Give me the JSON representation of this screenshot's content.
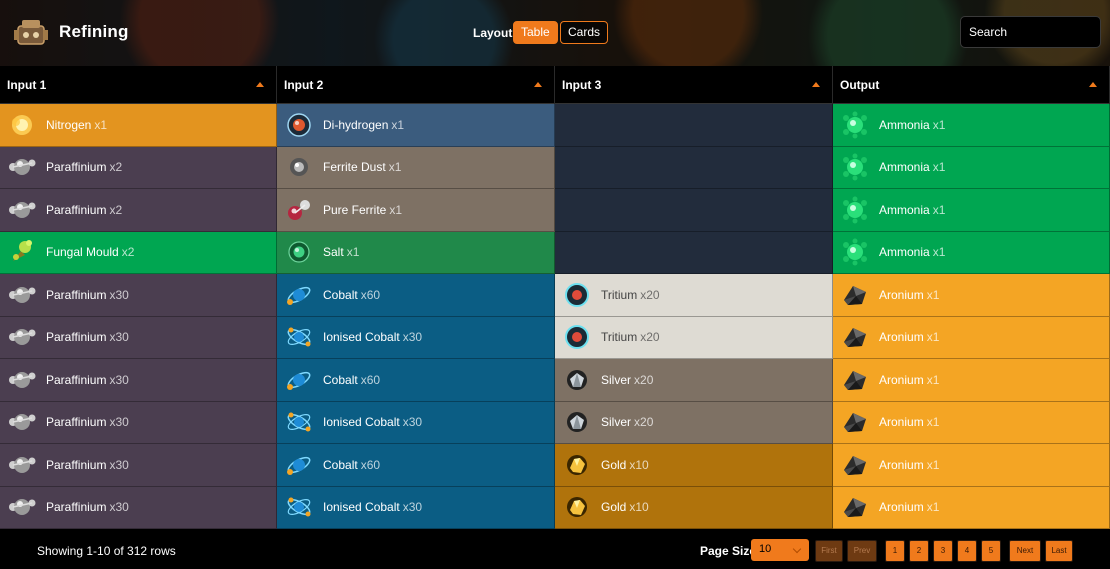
{
  "header": {
    "title": "Refining",
    "layout_label": "Layout:",
    "layout_options": [
      "Table",
      "Cards"
    ],
    "selected_layout": "Table",
    "search_placeholder": "Search"
  },
  "columns": [
    "Input 1",
    "Input 2",
    "Input 3",
    "Output"
  ],
  "rows": [
    {
      "input1": {
        "name": "Nitrogen",
        "qty": "x1",
        "icon": "nitrogen-icon",
        "bg": "#e3941f"
      },
      "input2": {
        "name": "Di-hydrogen",
        "qty": "x1",
        "icon": "di-hydrogen-icon",
        "bg": "#3b5c7e"
      },
      "input3": {
        "name": "",
        "qty": "",
        "icon": "",
        "bg": "#222c3c"
      },
      "output": {
        "name": "Ammonia",
        "qty": "x1",
        "icon": "ammonia-icon",
        "bg": "#00a651"
      }
    },
    {
      "input1": {
        "name": "Paraffinium",
        "qty": "x2",
        "icon": "paraffinium-icon",
        "bg": "#4b3e50"
      },
      "input2": {
        "name": "Ferrite Dust",
        "qty": "x1",
        "icon": "ferrite-dust-icon",
        "bg": "#7e7164"
      },
      "input3": {
        "name": "",
        "qty": "",
        "icon": "",
        "bg": "#222c3c"
      },
      "output": {
        "name": "Ammonia",
        "qty": "x1",
        "icon": "ammonia-icon",
        "bg": "#00a651"
      }
    },
    {
      "input1": {
        "name": "Paraffinium",
        "qty": "x2",
        "icon": "paraffinium-icon",
        "bg": "#4b3e50"
      },
      "input2": {
        "name": "Pure Ferrite",
        "qty": "x1",
        "icon": "pure-ferrite-icon",
        "bg": "#7e7164"
      },
      "input3": {
        "name": "",
        "qty": "",
        "icon": "",
        "bg": "#222c3c"
      },
      "output": {
        "name": "Ammonia",
        "qty": "x1",
        "icon": "ammonia-icon",
        "bg": "#00a651"
      }
    },
    {
      "input1": {
        "name": "Fungal Mould",
        "qty": "x2",
        "icon": "fungal-mould-icon",
        "bg": "#00a651"
      },
      "input2": {
        "name": "Salt",
        "qty": "x1",
        "icon": "salt-icon",
        "bg": "#20894a"
      },
      "input3": {
        "name": "",
        "qty": "",
        "icon": "",
        "bg": "#222c3c"
      },
      "output": {
        "name": "Ammonia",
        "qty": "x1",
        "icon": "ammonia-icon",
        "bg": "#00a651"
      }
    },
    {
      "input1": {
        "name": "Paraffinium",
        "qty": "x30",
        "icon": "paraffinium-icon",
        "bg": "#4b3e50"
      },
      "input2": {
        "name": "Cobalt",
        "qty": "x60",
        "icon": "cobalt-icon",
        "bg": "#0b5d84"
      },
      "input3": {
        "name": "Tritium",
        "qty": "x20",
        "icon": "tritium-icon",
        "bg": "#dedbd3"
      },
      "output": {
        "name": "Aronium",
        "qty": "x1",
        "icon": "aronium-icon",
        "bg": "#f4a524"
      }
    },
    {
      "input1": {
        "name": "Paraffinium",
        "qty": "x30",
        "icon": "paraffinium-icon",
        "bg": "#4b3e50"
      },
      "input2": {
        "name": "Ionised Cobalt",
        "qty": "x30",
        "icon": "ionised-cobalt-icon",
        "bg": "#0b5d84"
      },
      "input3": {
        "name": "Tritium",
        "qty": "x20",
        "icon": "tritium-icon",
        "bg": "#dedbd3"
      },
      "output": {
        "name": "Aronium",
        "qty": "x1",
        "icon": "aronium-icon",
        "bg": "#f4a524"
      }
    },
    {
      "input1": {
        "name": "Paraffinium",
        "qty": "x30",
        "icon": "paraffinium-icon",
        "bg": "#4b3e50"
      },
      "input2": {
        "name": "Cobalt",
        "qty": "x60",
        "icon": "cobalt-icon",
        "bg": "#0b5d84"
      },
      "input3": {
        "name": "Silver",
        "qty": "x20",
        "icon": "silver-icon",
        "bg": "#7e7164"
      },
      "output": {
        "name": "Aronium",
        "qty": "x1",
        "icon": "aronium-icon",
        "bg": "#f4a524"
      }
    },
    {
      "input1": {
        "name": "Paraffinium",
        "qty": "x30",
        "icon": "paraffinium-icon",
        "bg": "#4b3e50"
      },
      "input2": {
        "name": "Ionised Cobalt",
        "qty": "x30",
        "icon": "ionised-cobalt-icon",
        "bg": "#0b5d84"
      },
      "input3": {
        "name": "Silver",
        "qty": "x20",
        "icon": "silver-icon",
        "bg": "#7e7164"
      },
      "output": {
        "name": "Aronium",
        "qty": "x1",
        "icon": "aronium-icon",
        "bg": "#f4a524"
      }
    },
    {
      "input1": {
        "name": "Paraffinium",
        "qty": "x30",
        "icon": "paraffinium-icon",
        "bg": "#4b3e50"
      },
      "input2": {
        "name": "Cobalt",
        "qty": "x60",
        "icon": "cobalt-icon",
        "bg": "#0b5d84"
      },
      "input3": {
        "name": "Gold",
        "qty": "x10",
        "icon": "gold-icon",
        "bg": "#b0730c"
      },
      "output": {
        "name": "Aronium",
        "qty": "x1",
        "icon": "aronium-icon",
        "bg": "#f4a524"
      }
    },
    {
      "input1": {
        "name": "Paraffinium",
        "qty": "x30",
        "icon": "paraffinium-icon",
        "bg": "#4b3e50"
      },
      "input2": {
        "name": "Ionised Cobalt",
        "qty": "x30",
        "icon": "ionised-cobalt-icon",
        "bg": "#0b5d84"
      },
      "input3": {
        "name": "Gold",
        "qty": "x10",
        "icon": "gold-icon",
        "bg": "#b0730c"
      },
      "output": {
        "name": "Aronium",
        "qty": "x1",
        "icon": "aronium-icon",
        "bg": "#f4a524"
      }
    }
  ],
  "footer": {
    "showing": "Showing 1-10 of 312 rows",
    "page_size_label": "Page Size",
    "page_size": "10",
    "first": "First",
    "prev": "Prev",
    "pages": [
      "1",
      "2",
      "3",
      "4",
      "5"
    ],
    "next": "Next",
    "last": "Last"
  },
  "colors": {
    "accent": "#f07a1c"
  }
}
